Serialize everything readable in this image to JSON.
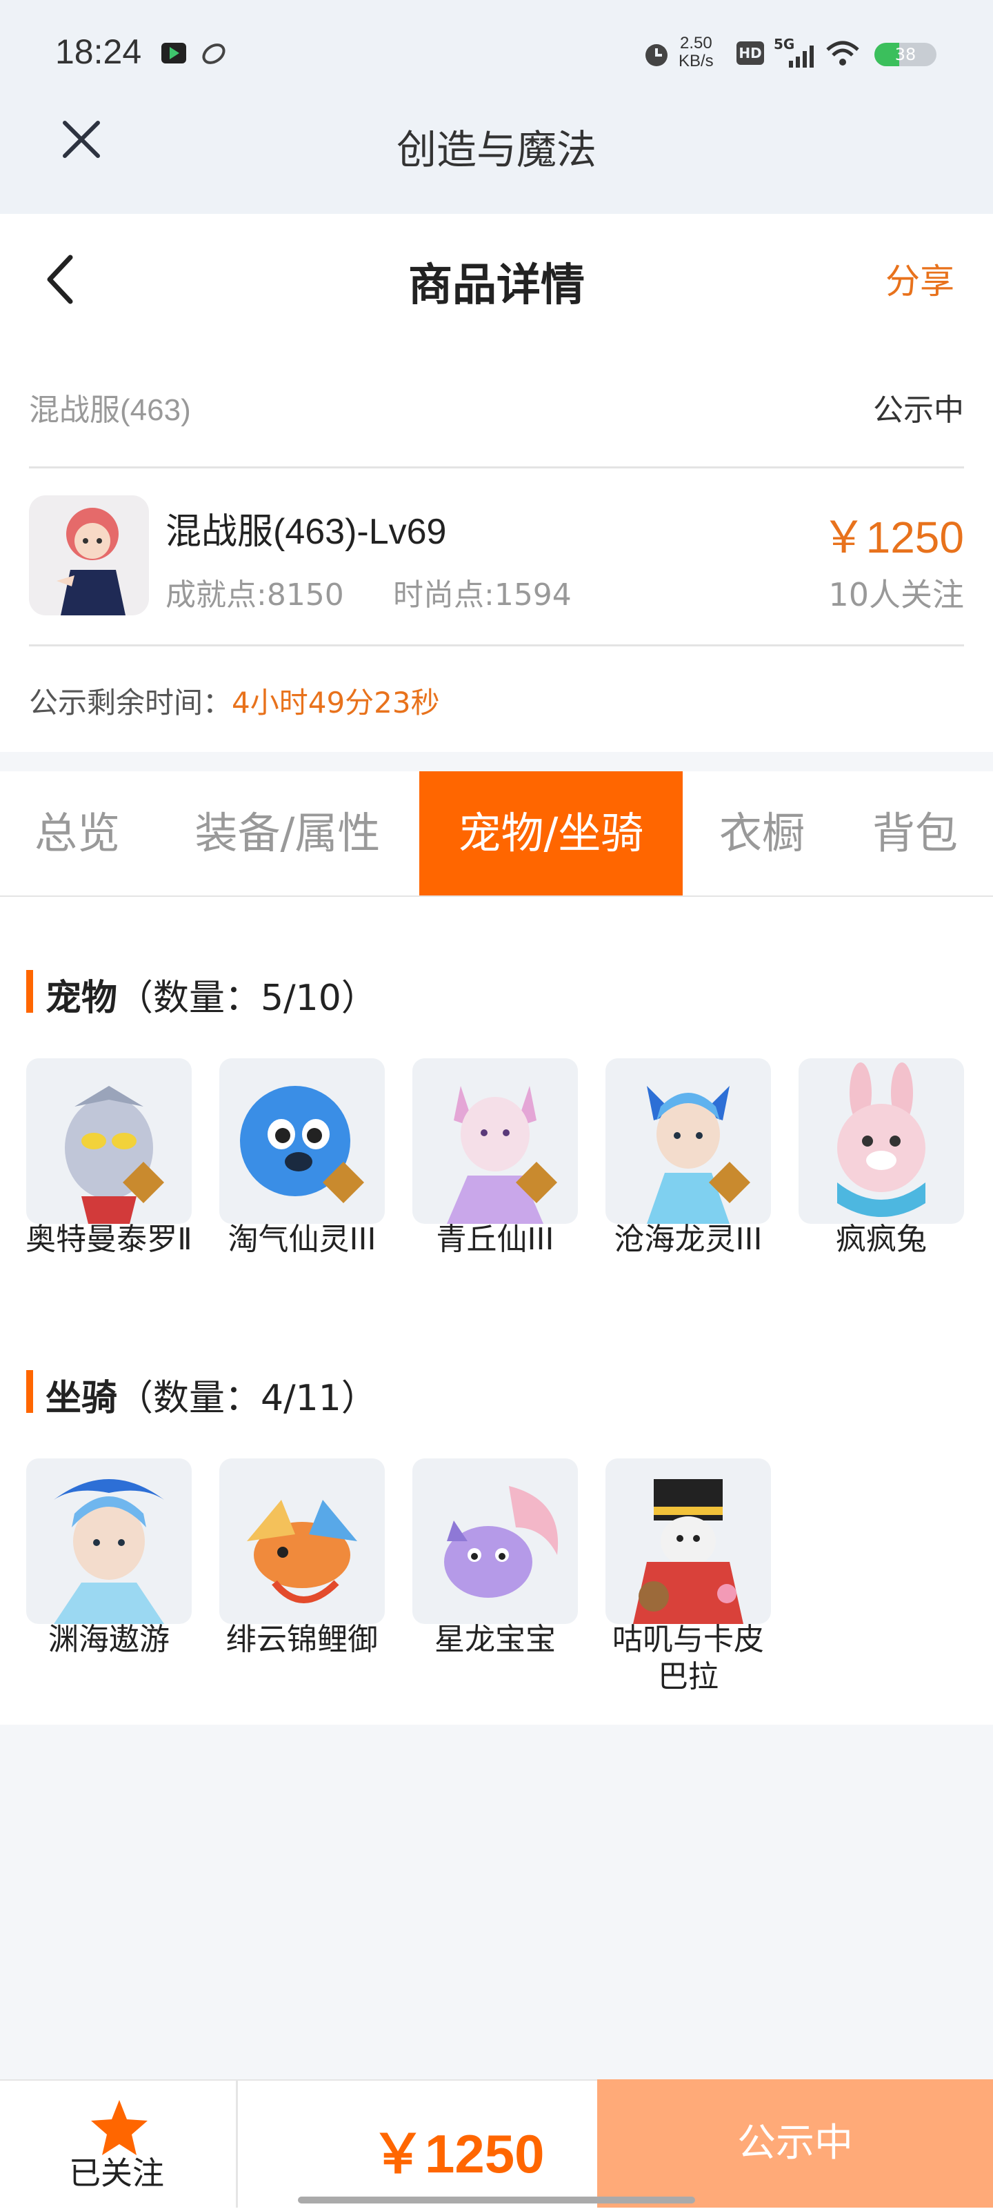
{
  "status_bar": {
    "time": "18:24",
    "net_speed": "2.50",
    "net_unit": "KB/s",
    "hd": "HD",
    "signal": "5G",
    "battery": "38"
  },
  "app": {
    "title": "创造与魔法"
  },
  "page": {
    "title": "商品详情",
    "share_label": "分享"
  },
  "listing": {
    "server": "混战服(463)",
    "status": "公示中",
    "name": "混战服(463)-Lv69",
    "achievement": "成就点:8150",
    "fashion": "时尚点:1594",
    "price": "￥1250",
    "followers": "10人关注",
    "remaining_label": "公示剩余时间：",
    "remaining_value": "4小时49分23秒"
  },
  "tabs": [
    "总览",
    "装备/属性",
    "宠物/坐骑",
    "衣橱",
    "背包"
  ],
  "active_tab": 2,
  "pets": {
    "title": "宠物",
    "count": "（数量：5/10）",
    "items": [
      {
        "label": "奥特曼泰罗Ⅱ",
        "tier": "II",
        "color": "#c0c6d8"
      },
      {
        "label": "淘气仙灵III",
        "tier": "III",
        "color": "#3a8ee6"
      },
      {
        "label": "青丘仙III",
        "tier": "III",
        "color": "#e9b9d8"
      },
      {
        "label": "沧海龙灵III",
        "tier": "III",
        "color": "#5fb2ee"
      },
      {
        "label": "疯疯兔",
        "tier": "",
        "color": "#f3c1cc"
      }
    ]
  },
  "mounts": {
    "title": "坐骑",
    "count": "（数量：4/11）",
    "items": [
      {
        "label": "渊海遨游",
        "color": "#6fb6ee"
      },
      {
        "label": "绯云锦鲤御",
        "color": "#f08a3c"
      },
      {
        "label": "星龙宝宝",
        "color": "#b59ae8"
      },
      {
        "label": "咕叽与卡皮巴拉",
        "color": "#d9413a"
      }
    ]
  },
  "bottom": {
    "follow_label": "已关注",
    "price": "￥1250",
    "action": "公示中"
  },
  "colors": {
    "accent": "#ff6600",
    "price": "#e8721c",
    "action_bg": "#ffaa78"
  }
}
